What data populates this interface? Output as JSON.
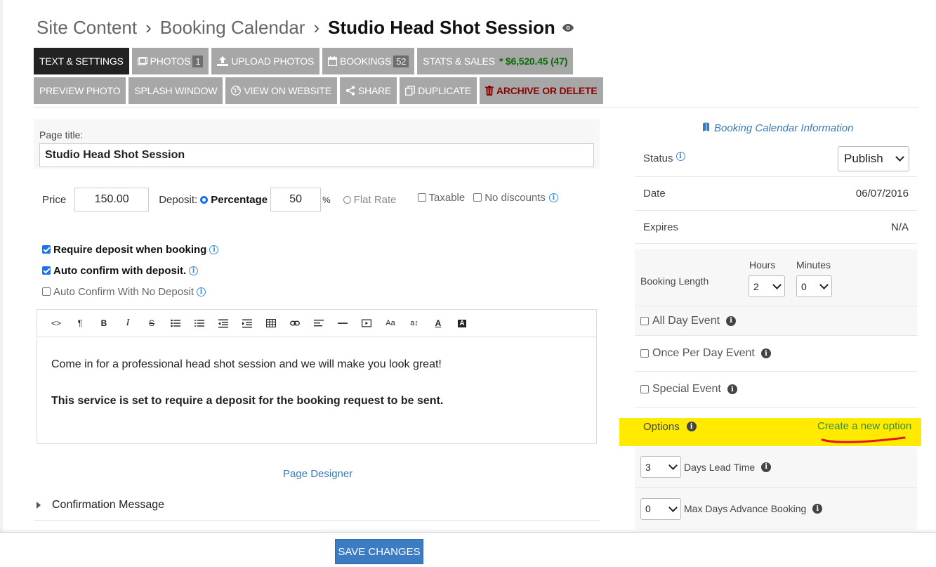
{
  "breadcrumb": {
    "site_content": "Site Content",
    "booking_calendar": "Booking Calendar",
    "current": "Studio Head Shot Session"
  },
  "tabs": {
    "text_settings": "TEXT & SETTINGS",
    "photos": "PHOTOS",
    "photos_count": "1",
    "upload_photos": "UPLOAD PHOTOS",
    "bookings": "BOOKINGS",
    "bookings_count": "52",
    "stats_sales": "STATS & SALES",
    "stats_value": "* $6,520.45 (47)",
    "preview_photo": "PREVIEW PHOTO",
    "splash_window": "SPLASH WINDOW",
    "view_on_website": "VIEW ON WEBSITE",
    "share": "SHARE",
    "duplicate": "DUPLICATE",
    "archive_delete": "ARCHIVE OR DELETE"
  },
  "form": {
    "page_title_label": "Page title:",
    "page_title_value": "Studio Head Shot Session",
    "price_label": "Price",
    "price_value": "150.00",
    "deposit_label": "Deposit:",
    "percentage_label": "Percentage",
    "percentage_value": "50",
    "percent_sign": "%",
    "flat_rate_label": "Flat Rate",
    "taxable_label": "Taxable",
    "no_discounts_label": "No discounts",
    "require_deposit_label": "Require deposit when booking",
    "auto_confirm_deposit_label": "Auto confirm with deposit.",
    "auto_confirm_no_deposit_label": "Auto Confirm With No Deposit"
  },
  "editor": {
    "paragraph1": "Come in for a professional head shot session and we will make you look great!",
    "paragraph2": "This service is set to require a deposit for the booking request to be sent."
  },
  "links": {
    "page_designer": "Page Designer",
    "confirmation_message": "Confirmation Message",
    "booking_calendar_info": "Booking Calendar Information",
    "create_option": "Create a new option"
  },
  "sidebar": {
    "status_label": "Status",
    "status_value": "Publish",
    "date_label": "Date",
    "date_value": "06/07/2016",
    "expires_label": "Expires",
    "expires_value": "N/A",
    "booking_length_label": "Booking Length",
    "hours_label": "Hours",
    "hours_value": "2",
    "minutes_label": "Minutes",
    "minutes_value": "0",
    "all_day_label": "All Day Event",
    "once_per_day_label": "Once Per Day Event",
    "special_event_label": "Special Event",
    "options_label": "Options",
    "lead_time_value": "3",
    "lead_time_label": "Days Lead Time",
    "max_days_value": "0",
    "max_days_label": "Max Days Advance Booking"
  },
  "footer": {
    "save_label": "SAVE CHANGES"
  },
  "colors": {
    "highlight": "#ffea00",
    "accent_blue": "#3c7cc2",
    "stats_green": "#0a6b0a",
    "danger": "#8b0000"
  }
}
